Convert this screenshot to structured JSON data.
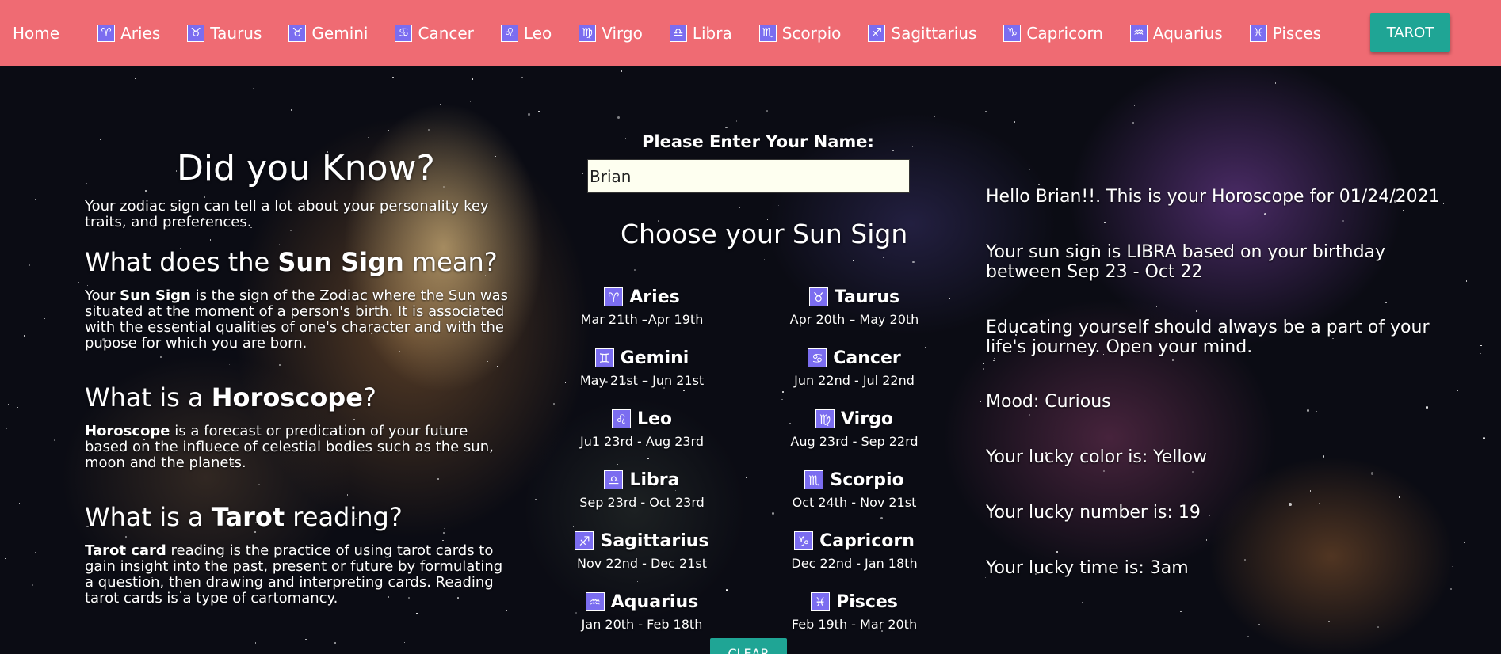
{
  "nav": {
    "home": "Home",
    "items": [
      {
        "label": "Aries",
        "glyph": "♈"
      },
      {
        "label": "Taurus",
        "glyph": "♉"
      },
      {
        "label": "Gemini",
        "glyph": "♉"
      },
      {
        "label": "Cancer",
        "glyph": "♋"
      },
      {
        "label": "Leo",
        "glyph": "♌"
      },
      {
        "label": "Virgo",
        "glyph": "♍"
      },
      {
        "label": "Libra",
        "glyph": "♎"
      },
      {
        "label": "Scorpio",
        "glyph": "♏"
      },
      {
        "label": "Sagittarius",
        "glyph": "♐"
      },
      {
        "label": "Capricorn",
        "glyph": "♑"
      },
      {
        "label": "Aquarius",
        "glyph": "♒"
      },
      {
        "label": "Pisces",
        "glyph": "♓"
      }
    ],
    "tarot_label": "TAROT"
  },
  "info": {
    "did_title": "Did you Know?",
    "did_text": "Your zodiac sign can tell a lot about your personality key traits, and preferences.",
    "sun_heading_pre": "What does the ",
    "sun_heading_bold": "Sun Sign",
    "sun_heading_post": " mean?",
    "sun_text_pre": "Your ",
    "sun_text_bold": "Sun Sign",
    "sun_text_post": " is the sign of the Zodiac where the Sun was situated at the moment of a person's birth. It is associated with the essential qualities of one's character and with the pupose for which you are born.",
    "horo_heading_pre": "What is a ",
    "horo_heading_bold": "Horoscope",
    "horo_heading_post": "?",
    "horo_text_bold": "Horoscope",
    "horo_text_post": " is a forecast or predication of your future based on the influece of celestial bodies such as the sun, moon and the planets.",
    "tarot_heading_pre": "What is a ",
    "tarot_heading_bold": "Tarot",
    "tarot_heading_post": " reading?",
    "tarot_text_bold": "Tarot card",
    "tarot_text_post": " reading is the practice of using tarot cards to gain insight into the past, present or future by formulating a question, then drawing and interpreting cards. Reading tarot cards is a type of cartomancy."
  },
  "form": {
    "name_label": "Please Enter Your Name:",
    "name_value": "Brian",
    "choose_title": "Choose your Sun Sign",
    "clear_label": "CLEAR"
  },
  "signs": [
    {
      "name": "Aries",
      "glyph": "♈",
      "dates": "Mar 21th –Apr 19th"
    },
    {
      "name": "Taurus",
      "glyph": "♉",
      "dates": "Apr 20th – May 20th"
    },
    {
      "name": "Gemini",
      "glyph": "♊",
      "dates": "May 21st – Jun 21st"
    },
    {
      "name": "Cancer",
      "glyph": "♋",
      "dates": "Jun 22nd - Jul 22nd"
    },
    {
      "name": "Leo",
      "glyph": "♌",
      "dates": "Ju1 23rd - Aug 23rd"
    },
    {
      "name": "Virgo",
      "glyph": "♍",
      "dates": "Aug 23rd - Sep 22rd"
    },
    {
      "name": "Libra",
      "glyph": "♎",
      "dates": "Sep 23rd - Oct 23rd"
    },
    {
      "name": "Scorpio",
      "glyph": "♏",
      "dates": "Oct 24th - Nov 21st"
    },
    {
      "name": "Sagittarius",
      "glyph": "♐",
      "dates": "Nov 22nd - Dec 21st"
    },
    {
      "name": "Capricorn",
      "glyph": "♑",
      "dates": "Dec 22nd - Jan 18th"
    },
    {
      "name": "Aquarius",
      "glyph": "♒",
      "dates": "Jan 20th - Feb 18th"
    },
    {
      "name": "Pisces",
      "glyph": "♓",
      "dates": "Feb 19th - Mar 20th"
    }
  ],
  "result": {
    "greeting": "Hello Brian!!. This is your Horoscope for 01/24/2021",
    "sun_sign": "Your sun sign is LIBRA based on your birthday between Sep 23 - Oct 22",
    "reading": "Educating yourself should always be a part of your life's journey. Open your mind.",
    "mood": "Mood: Curious",
    "lucky_color": "Your lucky color is: Yellow",
    "lucky_number": "Your lucky number is: 19",
    "lucky_time": "Your lucky time is: 3am"
  },
  "colors": {
    "nav_bg": "#ef6b73",
    "accent_button": "#1fa595",
    "glyph_bg": "#7b6df0",
    "input_bg": "#fefff0"
  }
}
